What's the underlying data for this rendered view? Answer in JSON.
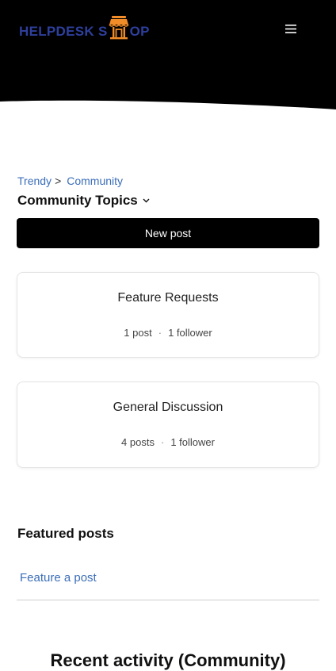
{
  "header": {
    "logo_text_left": "HELPDESK S",
    "logo_text_right": "OP",
    "logo_icon": "store-icon",
    "menu_icon": "hamburger-menu-icon",
    "colors": {
      "background": "#000000",
      "logo_blue": "#2e3f9c",
      "logo_orange": "#f28c28"
    }
  },
  "breadcrumb": {
    "items": [
      {
        "label": "Trendy"
      },
      {
        "label": "Community"
      }
    ],
    "separator": ">"
  },
  "topics_filter": {
    "label": "Community Topics",
    "icon": "chevron-down-icon"
  },
  "new_post_label": "New post",
  "topics": [
    {
      "title": "Feature Requests",
      "posts": "1 post",
      "followers": "1 follower"
    },
    {
      "title": "General Discussion",
      "posts": "4 posts",
      "followers": "1 follower"
    }
  ],
  "featured": {
    "title": "Featured posts",
    "link": "Feature a post"
  },
  "recent_activity_title": "Recent activity (Community)",
  "colors": {
    "link": "#3b6eb8",
    "button": "#000000",
    "card_border": "#e4e4e4"
  }
}
